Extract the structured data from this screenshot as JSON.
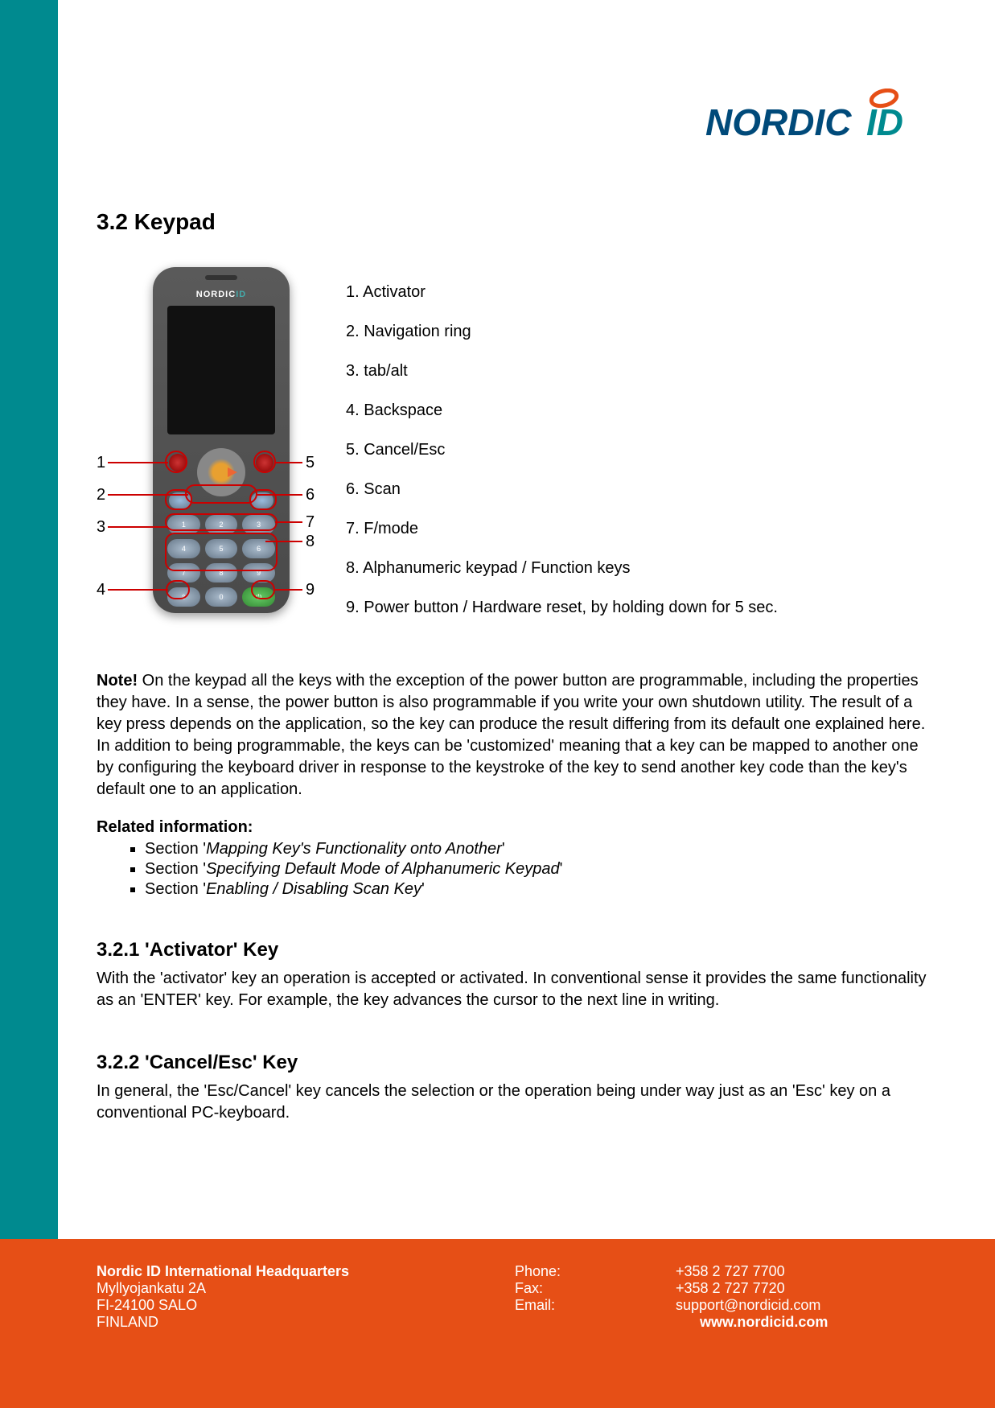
{
  "logo": {
    "text_main": "NORDIC",
    "text_accent": "ID"
  },
  "section": {
    "title": "3.2 Keypad"
  },
  "diagram": {
    "labels_left": {
      "1": "1",
      "2": "2",
      "3": "3",
      "4": "4"
    },
    "labels_right": {
      "5": "5",
      "6": "6",
      "7": "7",
      "8": "8",
      "9": "9"
    },
    "device_brand_main": "NORDIC",
    "device_brand_accent": "ID"
  },
  "legend": {
    "l1": "1. Activator",
    "l2": "2. Navigation ring",
    "l3": "3. tab/alt",
    "l4": "4. Backspace",
    "l5": "5. Cancel/Esc",
    "l6": "6. Scan",
    "l7": "7. F/mode",
    "l8": "8. Alphanumeric keypad / Function keys",
    "l9": "9. Power button / Hardware reset, by holding down for 5 sec."
  },
  "note": {
    "bold": "Note!",
    "text": " On the keypad all the keys with the exception of the power button are programmable, including the properties they have. In a sense, the power button is also programmable if you write your own shutdown utility. The result of a key press depends on the application, so the key can produce the result differing from its default one explained here. In addition to being programmable, the keys can be 'customized' meaning that a key can be mapped to another one by configuring the keyboard driver in response to the keystroke of the key to send another key code than the key's default one to an application."
  },
  "related": {
    "heading": "Related information:",
    "r1_pre": "Section '",
    "r1_title": "Mapping Key's Functionality onto Another",
    "r1_post": "'",
    "r2_pre": "Section '",
    "r2_title": "Specifying Default Mode of Alphanumeric Keypad",
    "r2_post": "'",
    "r3_pre": "Section '",
    "r3_title": "Enabling / Disabling Scan Key",
    "r3_post": "'"
  },
  "sub1": {
    "title": "3.2.1 'Activator' Key",
    "text": "With the 'activator' key an operation is accepted or activated. In conventional sense it provides the same functionality as an 'ENTER' key. For example, the key advances the cursor to the next line in writing."
  },
  "sub2": {
    "title": "3.2.2 'Cancel/Esc' Key",
    "text": "In general, the 'Esc/Cancel' key cancels the selection or the operation being under way just as an 'Esc' key on a conventional PC-keyboard."
  },
  "footer": {
    "hq": "Nordic ID International Headquarters",
    "addr1": "Myllyojankatu 2A",
    "addr2": "FI-24100 SALO",
    "addr3": "FINLAND",
    "phone_label": "Phone:",
    "fax_label": "Fax:",
    "email_label": "Email:",
    "phone": "+358 2 727 7700",
    "fax": "+358 2 727 7720",
    "email": "support@nordicid.com",
    "web": "www.nordicid.com"
  }
}
